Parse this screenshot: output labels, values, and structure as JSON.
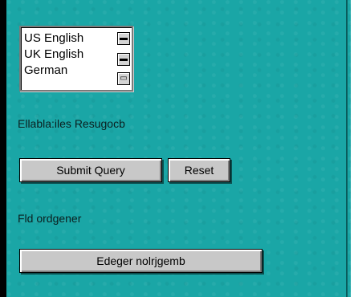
{
  "listbox": {
    "items": [
      "US English",
      "UK English",
      "German"
    ],
    "scroll_up_icon": "scroll-up-arrow",
    "scroll_down_icon": "scroll-down-arrow"
  },
  "form": {
    "field_label": "Ellabla:iles Resugocb",
    "submit_label": "Submit Query",
    "reset_label": "Reset",
    "section_label": "Fld ordgener",
    "action_label": "Edeger nolrjgemb"
  }
}
